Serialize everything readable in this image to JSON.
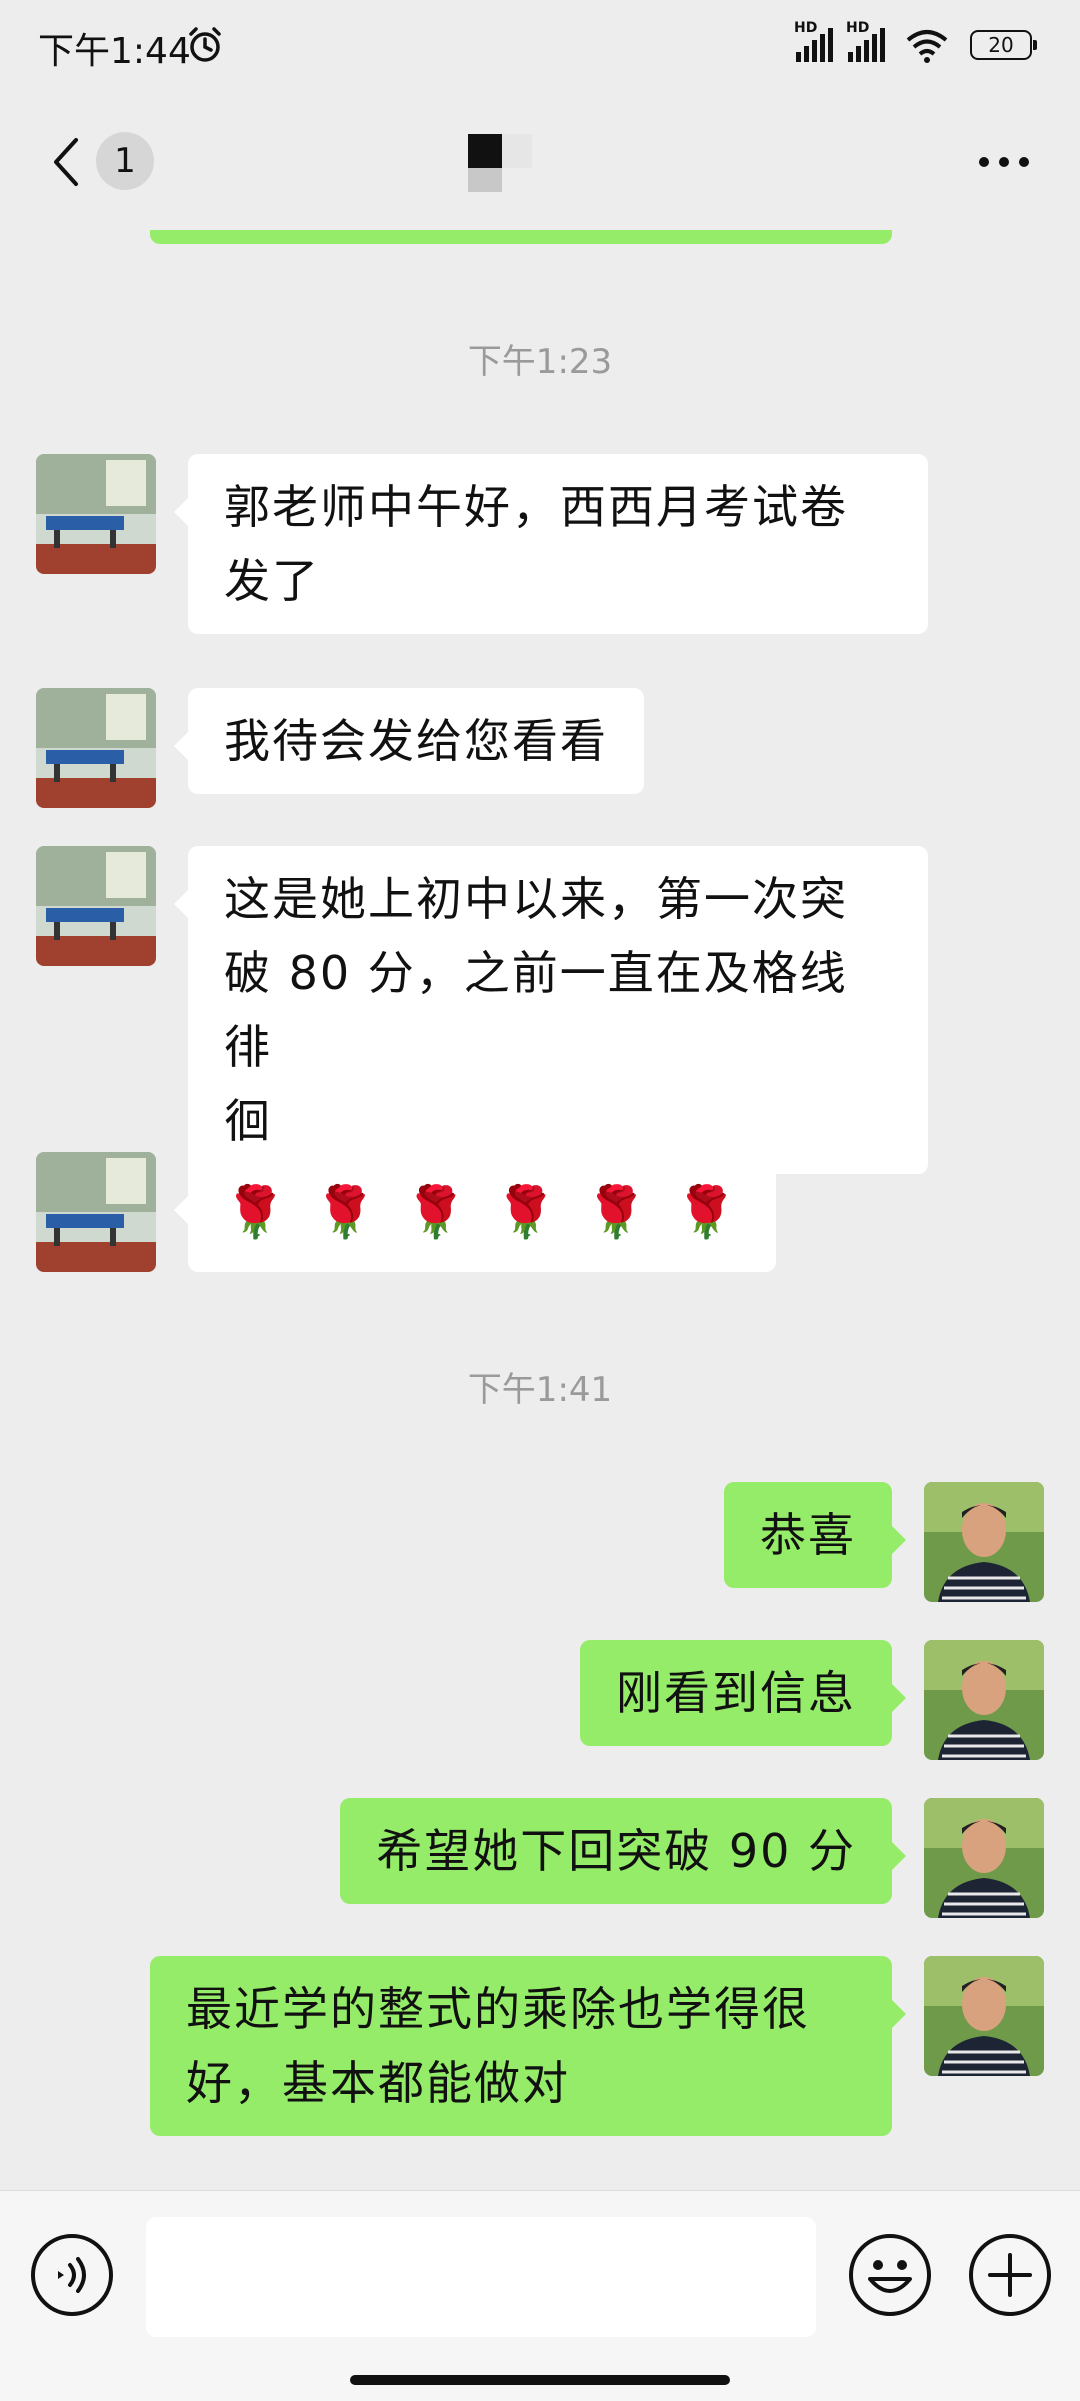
{
  "status_bar": {
    "time": "下午1:44",
    "signal_1_label": "HD",
    "signal_2_label": "HD",
    "battery": "20",
    "icons": [
      "alarm-icon",
      "signal-icon",
      "signal-icon",
      "wifi-icon",
      "battery-icon"
    ]
  },
  "nav": {
    "back_icon": "chevron-left-icon",
    "unread_count": "1",
    "more_icon": "more-dots-icon"
  },
  "chat": {
    "messages": [
      {
        "type": "timestamp",
        "text": "下午1:23"
      },
      {
        "type": "incoming",
        "text": "郭老师中午好，西西月考试卷发了",
        "line1": "郭老师中午好，西西月考试卷",
        "line2": "发了"
      },
      {
        "type": "incoming",
        "text": "我待会发给您看看"
      },
      {
        "type": "incoming",
        "text": "这是她上初中以来，第一次突破80分，之前一直在及格线徘徊",
        "line1": "这是她上初中以来，第一次突",
        "line2": "破 80 分，之前一直在及格线徘",
        "line3": "徊"
      },
      {
        "type": "incoming",
        "text": "🌹🌹🌹🌹🌹🌹",
        "emoji": "🌹",
        "emoji_count": 6
      },
      {
        "type": "timestamp",
        "text": "下午1:41"
      },
      {
        "type": "outgoing",
        "text": "恭喜"
      },
      {
        "type": "outgoing",
        "text": "刚看到信息"
      },
      {
        "type": "outgoing",
        "text": "希望她下回突破 90 分"
      },
      {
        "type": "outgoing",
        "text": "最近学的整式的乘除也学得很好，基本都能做对",
        "line1": "最近学的整式的乘除也学得很",
        "line2": "好，基本都能做对"
      }
    ]
  },
  "input_bar": {
    "input_value": "",
    "voice_icon": "voice-icon",
    "emoji_icon": "emoji-icon",
    "plus_icon": "plus-icon"
  },
  "colors": {
    "background": "#ededed",
    "outgoing_bubble": "#95ec69",
    "incoming_bubble": "#ffffff",
    "timestamp_text": "#9a9a9a"
  }
}
